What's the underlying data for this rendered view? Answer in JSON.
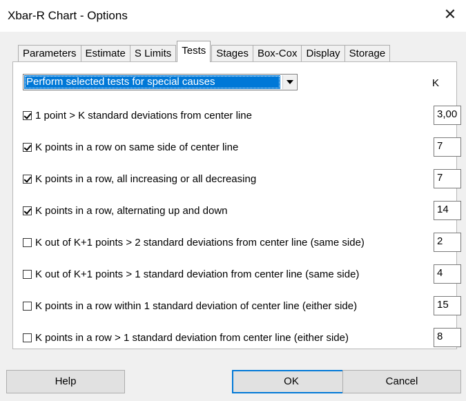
{
  "window": {
    "title": "Xbar-R Chart - Options",
    "close_glyph": "✕"
  },
  "tabs": [
    {
      "label": "Parameters"
    },
    {
      "label": "Estimate"
    },
    {
      "label": "S Limits"
    },
    {
      "label": "Tests"
    },
    {
      "label": "Stages"
    },
    {
      "label": "Box-Cox"
    },
    {
      "label": "Display"
    },
    {
      "label": "Storage"
    }
  ],
  "active_tab": "Tests",
  "tests_select": {
    "selected": "Perform selected tests for special causes"
  },
  "k_column_header": "K",
  "tests": [
    {
      "label": "1 point > K standard deviations from center line",
      "checked": true,
      "k": "3,00"
    },
    {
      "label": "K points in a row on same side of center line",
      "checked": true,
      "k": "7"
    },
    {
      "label": "K points in a row, all increasing or all decreasing",
      "checked": true,
      "k": "7"
    },
    {
      "label": "K points in a row, alternating up and down",
      "checked": true,
      "k": "14"
    },
    {
      "label": "K out of K+1 points > 2 standard deviations from center line (same side)",
      "checked": false,
      "k": "2"
    },
    {
      "label": "K out of K+1 points > 1 standard deviation from center line (same side)",
      "checked": false,
      "k": "4"
    },
    {
      "label": "K points in a row within 1 standard deviation of center line (either side)",
      "checked": false,
      "k": "15"
    },
    {
      "label": "K points in a row > 1 standard deviation from center line (either side)",
      "checked": false,
      "k": "8"
    }
  ],
  "buttons": {
    "help": "Help",
    "ok": "OK",
    "cancel": "Cancel"
  },
  "colors": {
    "selection": "#0078d7",
    "dialog_bg": "#f0f0f0"
  }
}
